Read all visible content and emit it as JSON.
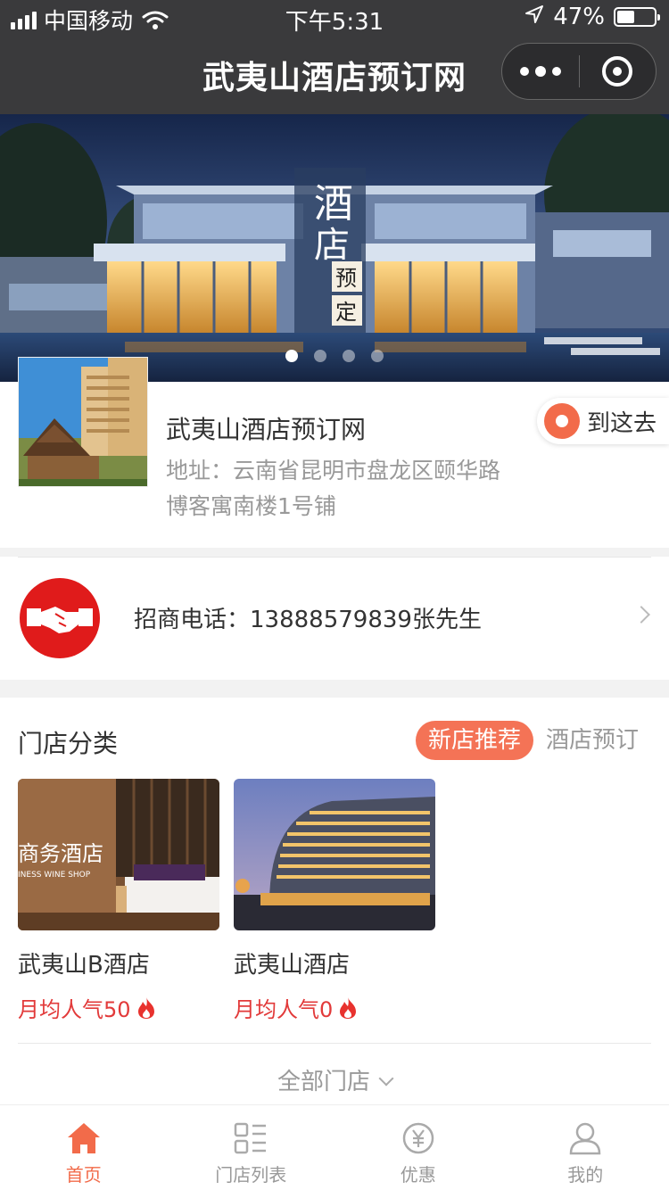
{
  "status_bar": {
    "carrier": "中国移动",
    "time": "下午5:31",
    "battery": "47%",
    "battery_level": 0.47
  },
  "nav": {
    "title": "武夷山酒店预订网"
  },
  "banner": {
    "slide_count": 4,
    "active_index": 0
  },
  "store": {
    "name": "武夷山酒店预订网",
    "address_line1": "地址：云南省昆明市盘龙区颐华路",
    "address_line2": "博客寓南楼1号铺",
    "navigate_label": "到这去"
  },
  "contact": {
    "phone_text": "招商电话：13888579839张先生"
  },
  "category": {
    "title": "门店分类",
    "tabs": [
      {
        "label": "新店推荐",
        "active": true
      },
      {
        "label": "酒店预订",
        "active": false
      }
    ],
    "stores": [
      {
        "name": "武夷山B酒店",
        "popularity": "月均人气50"
      },
      {
        "name": "武夷山酒店",
        "popularity": "月均人气0"
      }
    ],
    "all_label": "全部门店"
  },
  "tabbar": {
    "items": [
      {
        "label": "首页",
        "icon": "home-icon",
        "active": true
      },
      {
        "label": "门店列表",
        "icon": "list-icon",
        "active": false
      },
      {
        "label": "优惠",
        "icon": "coupon-icon",
        "active": false
      },
      {
        "label": "我的",
        "icon": "profile-icon",
        "active": false
      }
    ]
  },
  "colors": {
    "accent": "#f26b4a",
    "tab_active_bg": "#f47356",
    "popularity_red": "#e23a3a",
    "handshake_red": "#e01b1b",
    "header_bg": "#3a3a3c"
  }
}
